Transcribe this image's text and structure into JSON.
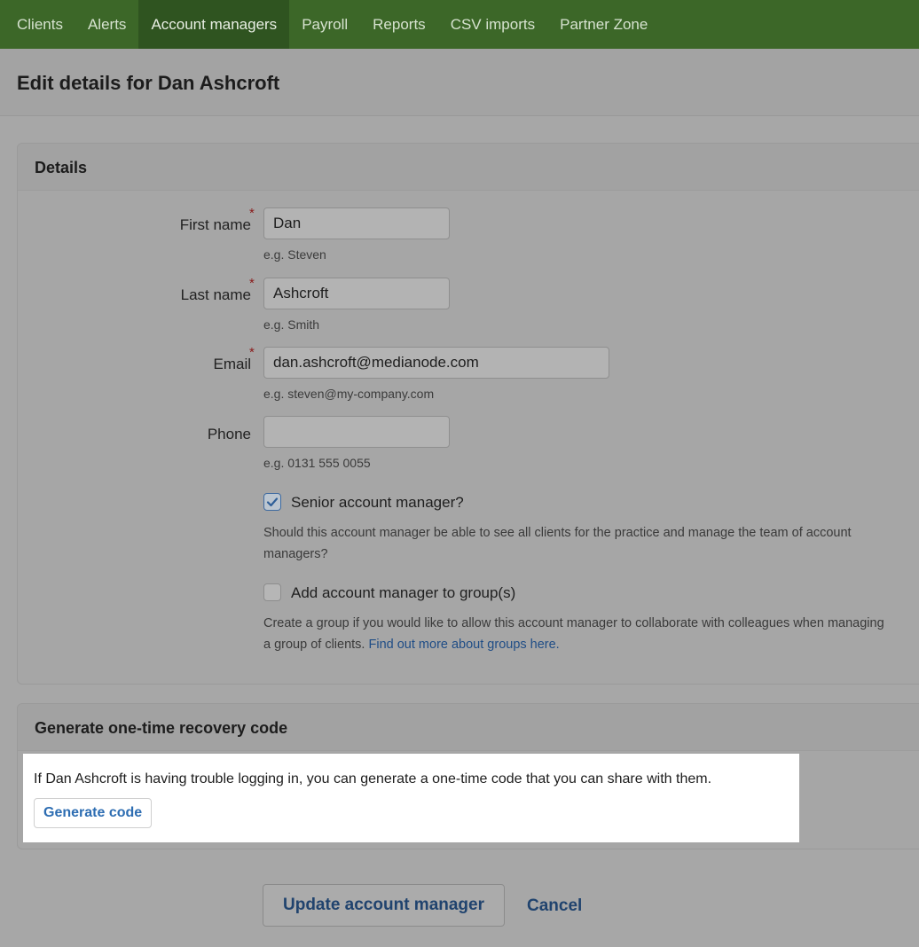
{
  "nav": {
    "items": [
      {
        "label": "Clients"
      },
      {
        "label": "Alerts"
      },
      {
        "label": "Account managers"
      },
      {
        "label": "Payroll"
      },
      {
        "label": "Reports"
      },
      {
        "label": "CSV imports"
      },
      {
        "label": "Partner Zone"
      }
    ],
    "active": "Account managers"
  },
  "page": {
    "title": "Edit details for Dan Ashcroft"
  },
  "details": {
    "title": "Details",
    "first_name": {
      "label": "First name",
      "value": "Dan",
      "hint": "e.g. Steven",
      "required": "*"
    },
    "last_name": {
      "label": "Last name",
      "value": "Ashcroft",
      "hint": "e.g. Smith",
      "required": "*"
    },
    "email": {
      "label": "Email",
      "value": "dan.ashcroft@medianode.com",
      "hint": "e.g. steven@my-company.com",
      "required": "*"
    },
    "phone": {
      "label": "Phone",
      "value": "",
      "hint": "e.g. 0131 555 0055"
    },
    "senior": {
      "label": "Senior account manager?",
      "checked": true,
      "description": "Should this account manager be able to see all clients for the practice and manage the team of account managers?"
    },
    "groups": {
      "label": "Add account manager to group(s)",
      "checked": false,
      "description": "Create a group if you would like to allow this account manager to collaborate with colleagues when managing a group of clients.",
      "link": "Find out more about groups here."
    }
  },
  "recovery": {
    "title": "Generate one-time recovery code",
    "text": "If Dan Ashcroft is having trouble logging in, you can generate a one-time code that you can share with them.",
    "button": "Generate code"
  },
  "actions": {
    "update": "Update account manager",
    "cancel": "Cancel"
  },
  "icons": {
    "checkmark": "check-icon"
  },
  "colors": {
    "nav_bg": "#3c6728",
    "link": "#2d6db2",
    "required": "#8a1a1a"
  }
}
